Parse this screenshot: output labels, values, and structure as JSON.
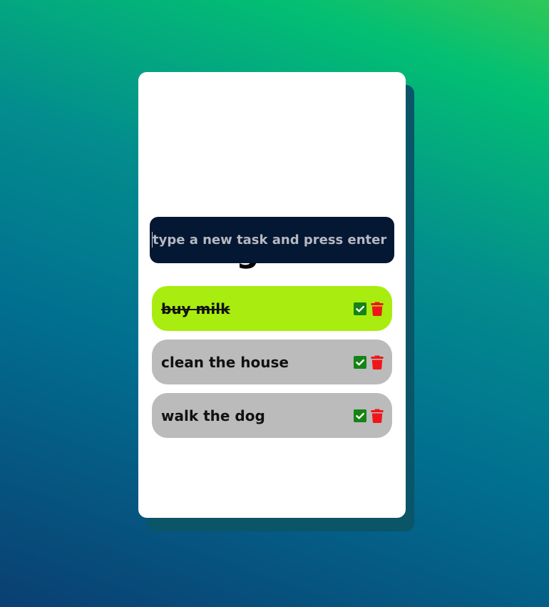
{
  "app": {
    "title": "things to do"
  },
  "input": {
    "placeholder": "type a new task and press enter",
    "value": ""
  },
  "tasks": [
    {
      "label": "buy milk",
      "completed": true
    },
    {
      "label": "clean the house",
      "completed": false
    },
    {
      "label": "walk the dog",
      "completed": false
    }
  ],
  "icons": {
    "complete": "check-square-icon",
    "delete": "trash-icon"
  },
  "colors": {
    "card_background": "#ffffff",
    "input_background": "#041733",
    "completed_task": "#a9ec0f",
    "pending_task": "#bbbbbb",
    "check_icon": "#158416",
    "trash_icon": "#f0151a"
  }
}
